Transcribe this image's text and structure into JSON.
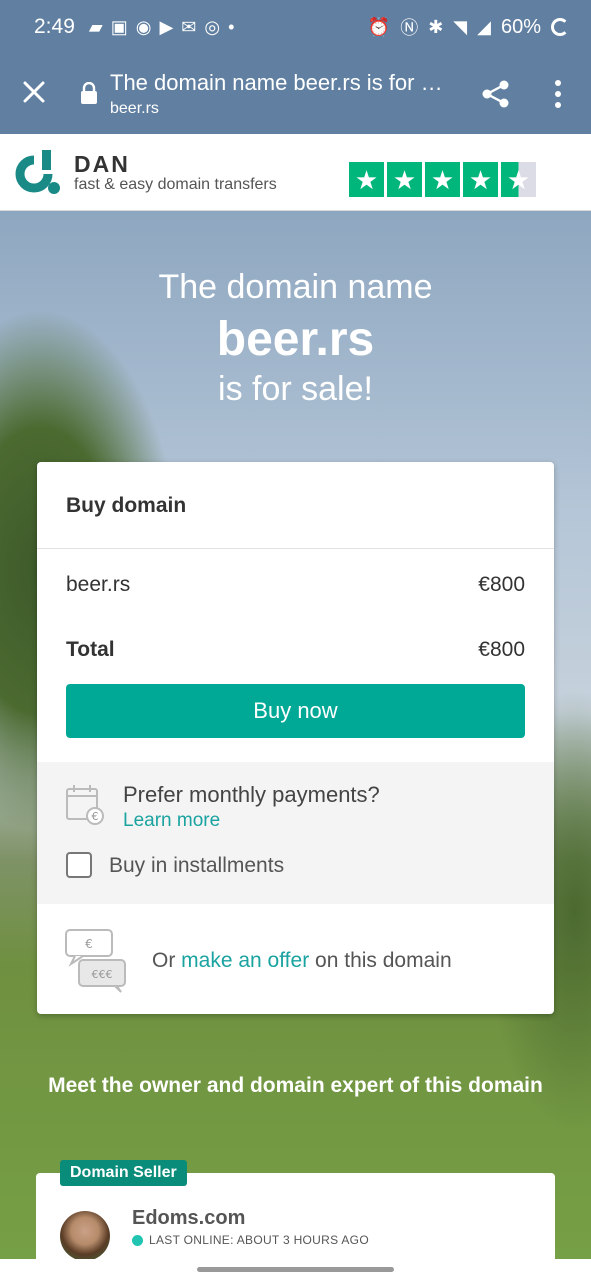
{
  "status_bar": {
    "time": "2:49",
    "battery": "60%"
  },
  "browser": {
    "page_title": "The domain name beer.rs is for …",
    "url": "beer.rs"
  },
  "brand": {
    "name": "DAN",
    "tagline": "fast & easy domain transfers",
    "rating_stars": 4.5,
    "accent_color": "#00b67a"
  },
  "hero": {
    "line1": "The domain name",
    "domain": "beer.rs",
    "line3": "is for sale!"
  },
  "purchase_card": {
    "heading": "Buy domain",
    "item_name": "beer.rs",
    "item_price": "€800",
    "total_label": "Total",
    "total_price": "€800",
    "buy_button": "Buy now",
    "monthly_prompt": "Prefer monthly payments?",
    "learn_more": "Learn more",
    "installments_label": "Buy in installments",
    "installments_checked": false,
    "offer_prefix": "Or",
    "offer_link": "make an offer",
    "offer_suffix": "on this domain",
    "button_color": "#00a896"
  },
  "meet_text": "Meet the owner and domain expert of this domain",
  "seller": {
    "badge": "Domain Seller",
    "name": "Edoms.com",
    "last_online": "LAST ONLINE: ABOUT 3 HOURS AGO"
  }
}
